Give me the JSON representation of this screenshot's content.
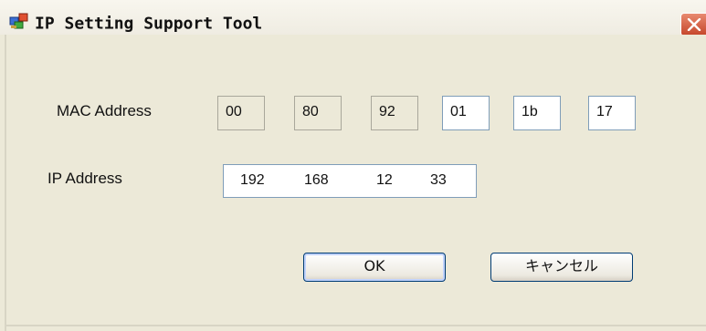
{
  "window": {
    "title": "IP Setting Support Tool",
    "icon": "network-computers-icon",
    "close_icon": "close-icon"
  },
  "form": {
    "mac_label": "MAC Address",
    "mac_octets": [
      {
        "value": "00",
        "editable": false
      },
      {
        "value": "80",
        "editable": false
      },
      {
        "value": "92",
        "editable": false
      },
      {
        "value": "01",
        "editable": true
      },
      {
        "value": "1b",
        "editable": true
      },
      {
        "value": "17",
        "editable": true
      }
    ],
    "ip_label": "IP Address",
    "ip_octets": [
      "192",
      "168",
      "12",
      "33"
    ]
  },
  "buttons": {
    "ok": "OK",
    "cancel": "キャンセル"
  },
  "colors": {
    "window_bg": "#ece9d8",
    "close_button": "#c5452a",
    "input_border": "#7f9db9",
    "button_border": "#003c74"
  }
}
